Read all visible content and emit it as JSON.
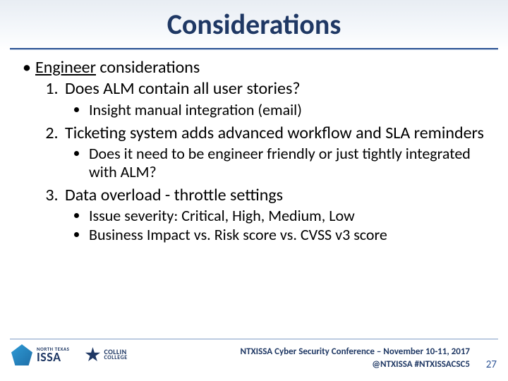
{
  "title": "Considerations",
  "section": {
    "underlined": "Engineer",
    "rest": " considerations"
  },
  "items": [
    {
      "text": "Does ALM contain all user stories?",
      "sub": [
        "Insight manual integration (email)"
      ]
    },
    {
      "text": "Ticketing system adds advanced workflow and SLA reminders",
      "sub": [
        "Does it need to be engineer friendly or just tightly integrated with ALM?"
      ]
    },
    {
      "text": "Data overload - throttle settings",
      "sub": [
        "Issue severity: Critical, High, Medium, Low",
        "Business Impact vs. Risk score vs. CVSS v3 score"
      ]
    }
  ],
  "footer": {
    "line1": "NTXISSA Cyber Security Conference – November 10-11, 2017",
    "line2": "@NTXISSA   #NTXISSACSC5",
    "page": "27",
    "logo1_small": "NORTH TEXAS",
    "logo1_big": "ISSA",
    "logo2_t1": "COLLIN",
    "logo2_t2": "COLLEGE"
  }
}
